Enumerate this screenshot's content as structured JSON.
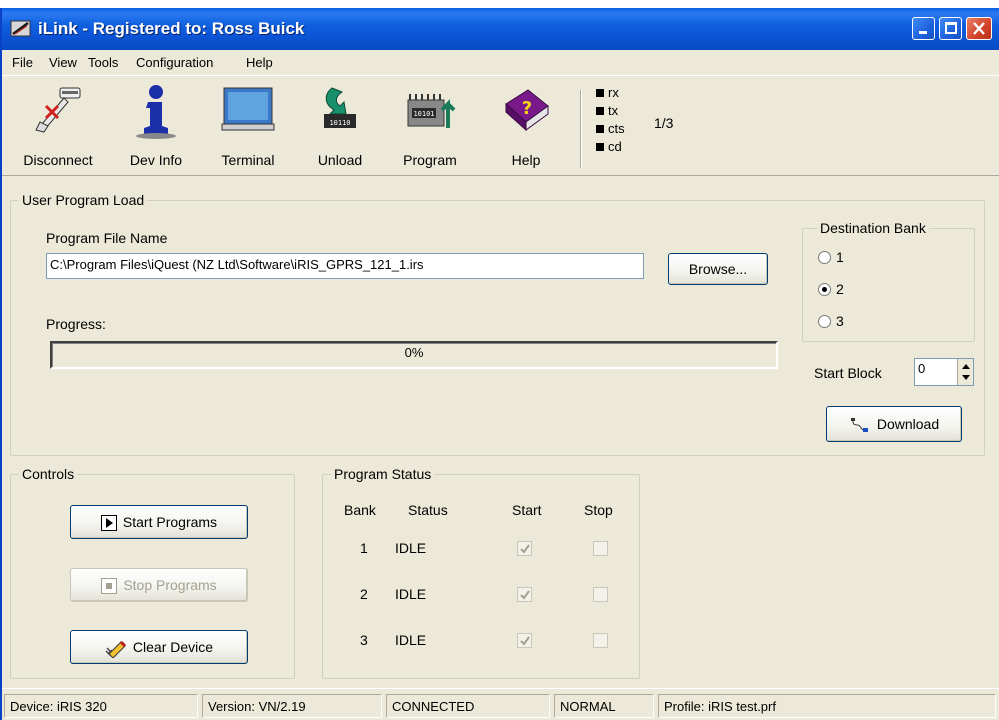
{
  "window": {
    "title": "iLink - Registered to: Ross Buick"
  },
  "menu": [
    {
      "label": "File"
    },
    {
      "label": "View"
    },
    {
      "label": "Tools"
    },
    {
      "label": "Configuration"
    },
    {
      "label": "Help"
    }
  ],
  "toolbar": {
    "disconnect": "Disconnect",
    "devinfo": "Dev Info",
    "terminal": "Terminal",
    "unload": "Unload",
    "program": "Program",
    "help": "Help",
    "leds": [
      "rx",
      "tx",
      "cts",
      "cd"
    ],
    "counter": "1/3"
  },
  "load": {
    "legend": "User Program Load",
    "file_label": "Program File Name",
    "file_value": "C:\\Program Files\\iQuest (NZ Ltd\\Software\\iRIS_GPRS_121_1.irs",
    "browse": "Browse...",
    "progress_label": "Progress:",
    "progress_text": "0%",
    "progress_value": 0,
    "dest_legend": "Destination Bank",
    "dest_options": [
      "1",
      "2",
      "3"
    ],
    "dest_selected": "2",
    "start_block_label": "Start Block",
    "start_block_value": "0",
    "download": "Download"
  },
  "controls": {
    "legend": "Controls",
    "start": "Start Programs",
    "stop": "Stop Programs",
    "clear": "Clear Device"
  },
  "status": {
    "legend": "Program Status",
    "headers": [
      "Bank",
      "Status",
      "Start",
      "Stop"
    ],
    "rows": [
      {
        "bank": "1",
        "status": "IDLE",
        "start": true,
        "stop": false
      },
      {
        "bank": "2",
        "status": "IDLE",
        "start": true,
        "stop": false
      },
      {
        "bank": "3",
        "status": "IDLE",
        "start": true,
        "stop": false
      }
    ]
  },
  "statusbar": {
    "device": "Device: iRIS 320",
    "version": "Version: VN/2.19",
    "connection": "CONNECTED",
    "mode": "NORMAL",
    "profile": "Profile: iRIS test.prf"
  }
}
